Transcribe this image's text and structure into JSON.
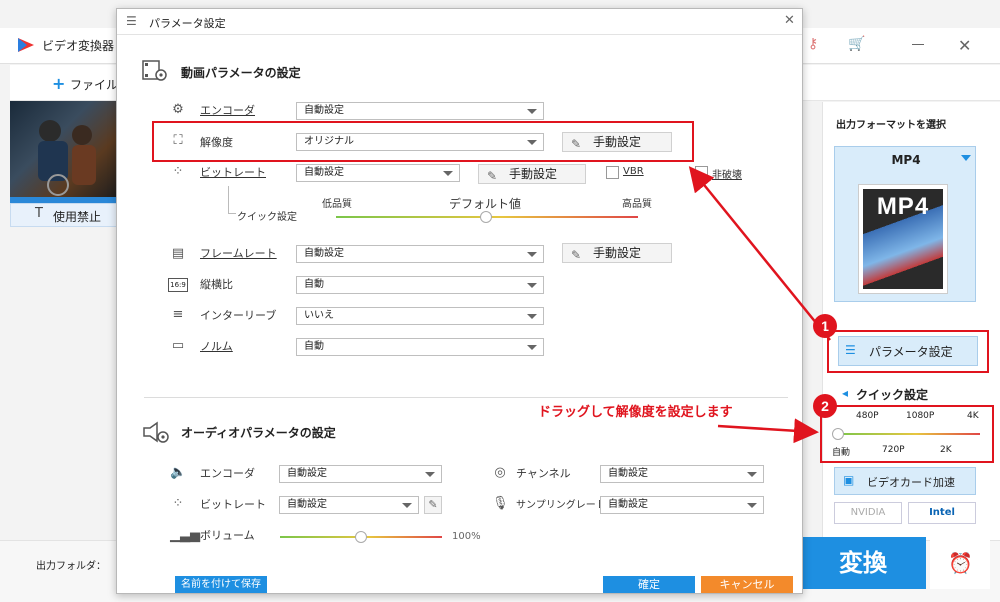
{
  "app": {
    "title": "ビデオ変換器",
    "toolbar_add": "ファイル",
    "disable_tab": "使用禁止",
    "output_folder_label": "出力フォルダ："
  },
  "right_panel": {
    "heading": "出力フォーマットを選択",
    "format": "MP4",
    "card_text": "MP4",
    "param_button": "パラメータ設定",
    "quick_title": "クイック設定",
    "quick_top_ticks": [
      "480P",
      "1080P",
      "4K"
    ],
    "quick_bottom_ticks": [
      "自動",
      "720P",
      "2K"
    ],
    "gpu_button": "ビデオカード加速",
    "vendor_nvidia": "NVIDIA",
    "vendor_intel": "Intel",
    "convert": "変換"
  },
  "dialog": {
    "title": "パラメータ設定",
    "video_section": "動画パラメータの設定",
    "encoder_label": "エンコーダ",
    "encoder_value": "自動設定",
    "resolution_label": "解像度",
    "resolution_value": "オリジナル",
    "manual": "手動設定",
    "bitrate_label": "ビットレート",
    "bitrate_value": "自動設定",
    "vbr": "VBR",
    "lossless": "非破壊",
    "quick_label": "クイック設定",
    "low_quality": "低品質",
    "default_value": "デフォルト値",
    "high_quality": "高品質",
    "framerate_label": "フレームレート",
    "framerate_value": "自動設定",
    "aspect_label": "縦横比",
    "aspect_value": "自動",
    "interleave_label": "インターリーブ",
    "interleave_value": "いいえ",
    "norm_label": "ノルム",
    "norm_value": "自動",
    "audio_section": "オーディオパラメータの設定",
    "a_encoder_label": "エンコーダ",
    "a_encoder_value": "自動設定",
    "channel_label": "チャンネル",
    "channel_value": "自動設定",
    "a_bitrate_label": "ビットレート",
    "a_bitrate_value": "自動設定",
    "sampling_label": "サンプリングレート",
    "sampling_value": "自動設定",
    "volume_label": "ボリューム",
    "volume_value": "100%",
    "save_as": "名前を付けて保存",
    "ok": "確定",
    "cancel": "キャンセル"
  },
  "annotation": {
    "note": "ドラッグして解像度を設定します",
    "badge1": "1",
    "badge2": "2"
  },
  "colors": {
    "accent": "#1e8fe1",
    "cancel": "#f38a2b",
    "annotation_red": "#e0141e"
  }
}
